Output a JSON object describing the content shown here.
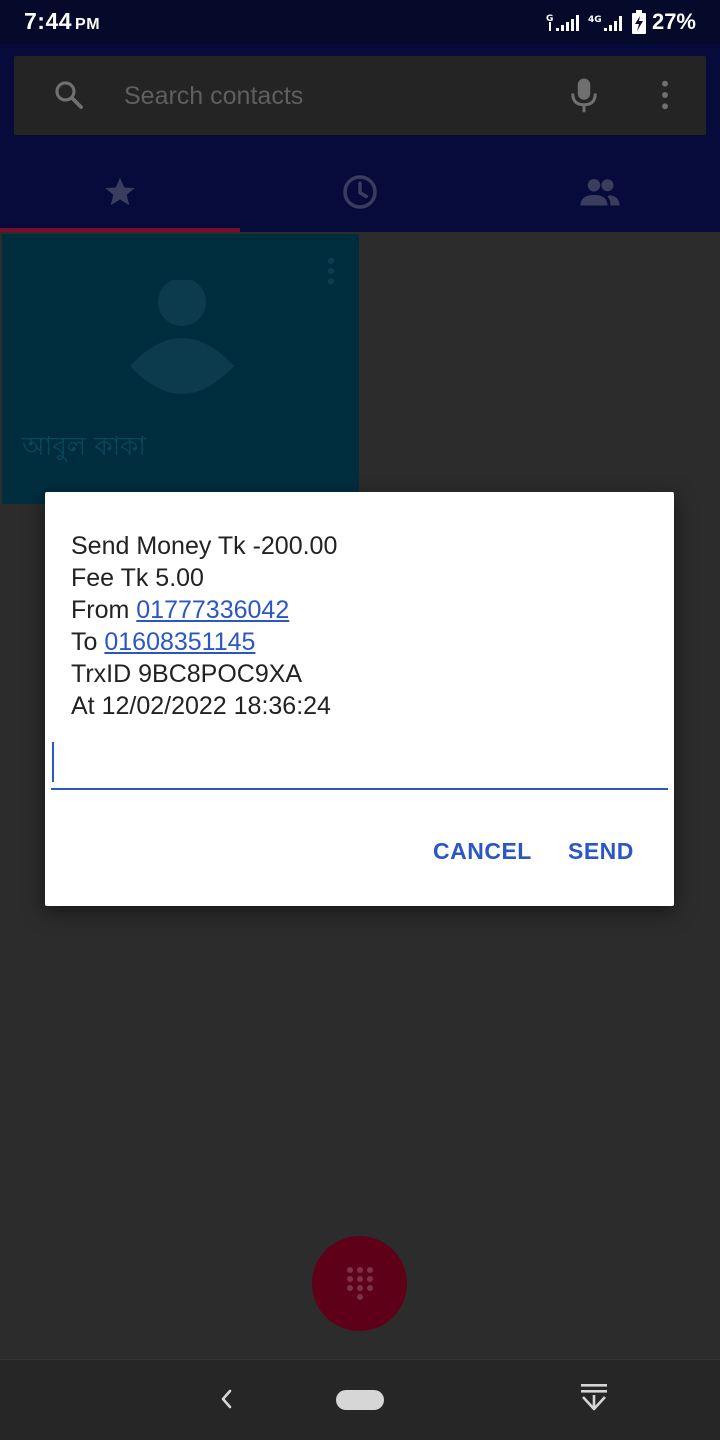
{
  "status_bar": {
    "time": "7:44",
    "ampm": "PM",
    "network_label": "4G",
    "battery_percent": "27%",
    "icons": [
      "signal-g-icon",
      "signal-bars-icon",
      "signal-4g-icon",
      "battery-charging-icon"
    ]
  },
  "search": {
    "placeholder": "Search contacts"
  },
  "tabs": [
    {
      "icon": "star-icon",
      "active": true
    },
    {
      "icon": "clock-icon",
      "active": false
    },
    {
      "icon": "people-icon",
      "active": false
    }
  ],
  "contact_tile": {
    "name": "আবুল কাকা"
  },
  "dialog": {
    "line1": "Send Money Tk -200.00",
    "line2": "Fee Tk 5.00",
    "from_label": "From",
    "from_number": "01777336042",
    "to_label": "To",
    "to_number": "01608351145",
    "line5": "TrxID 9BC8POC9XA",
    "line6": "At 12/02/2022 18:36:24",
    "reply_value": "",
    "cancel_label": "CANCEL",
    "send_label": "SEND"
  },
  "colors": {
    "accent": "#2a56c6",
    "appbar": "#070b3c",
    "tab_indicator": "#7a0d2a",
    "fab": "#5e0017",
    "tile": "#002d3e"
  }
}
